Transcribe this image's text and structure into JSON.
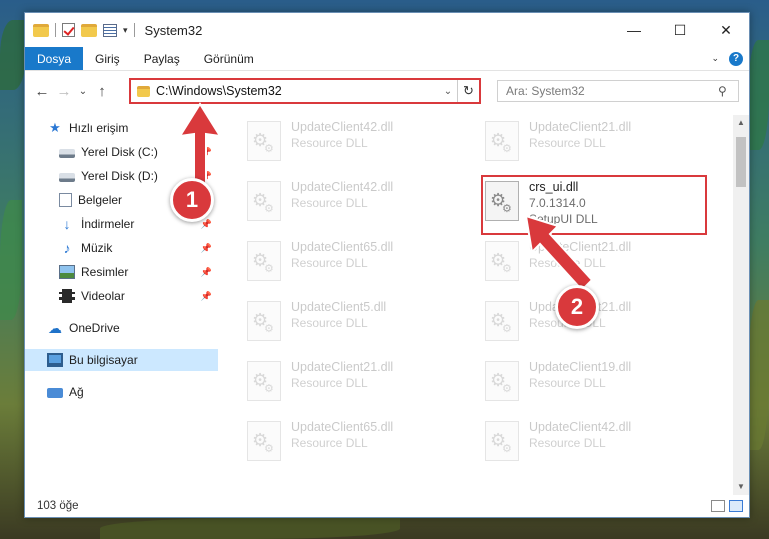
{
  "window": {
    "title": "System32",
    "controls": {
      "minimize": "—",
      "maximize": "☐",
      "close": "✕"
    }
  },
  "quick_access_toolbar": {
    "dropdown_glyph": "▾"
  },
  "ribbon": {
    "tabs": [
      {
        "label": "Dosya"
      },
      {
        "label": "Giriş"
      },
      {
        "label": "Paylaş"
      },
      {
        "label": "Görünüm"
      }
    ],
    "expand_glyph": "⌄",
    "help_glyph": "?"
  },
  "navigation": {
    "back_glyph": "←",
    "forward_glyph": "→",
    "recent_glyph": "⌄",
    "up_glyph": "↑",
    "address": "C:\\Windows\\System32",
    "address_dropdown_glyph": "⌄",
    "refresh_glyph": "↻",
    "search_placeholder": "Ara: System32",
    "search_glyph": "⚲"
  },
  "sidebar": {
    "items": [
      {
        "label": "Hızlı erişim",
        "icon": "star-icon",
        "pinned": false
      },
      {
        "label": "Yerel Disk (C:)",
        "icon": "drive-icon",
        "pinned": true
      },
      {
        "label": "Yerel Disk (D:)",
        "icon": "drive-icon",
        "pinned": true
      },
      {
        "label": "Belgeler",
        "icon": "documents-icon",
        "pinned": true
      },
      {
        "label": "İndirmeler",
        "icon": "downloads-icon",
        "pinned": true
      },
      {
        "label": "Müzik",
        "icon": "music-icon",
        "pinned": true
      },
      {
        "label": "Resimler",
        "icon": "pictures-icon",
        "pinned": true
      },
      {
        "label": "Videolar",
        "icon": "videos-icon",
        "pinned": true
      },
      {
        "label": "OneDrive",
        "icon": "cloud-icon",
        "pinned": false
      },
      {
        "label": "Bu bilgisayar",
        "icon": "computer-icon",
        "pinned": false,
        "selected": true
      },
      {
        "label": "Ağ",
        "icon": "network-icon",
        "pinned": false
      }
    ],
    "pin_glyph": "📌"
  },
  "files": {
    "left_column": [
      {
        "name": "UpdateClient42.dll",
        "type": "Resource DLL"
      },
      {
        "name": "UpdateClient42.dll",
        "type": "Resource DLL"
      },
      {
        "name": "UpdateClient65.dll",
        "type": "Resource DLL"
      },
      {
        "name": "UpdateClient5.dll",
        "type": "Resource DLL"
      },
      {
        "name": "UpdateClient21.dll",
        "type": "Resource DLL"
      },
      {
        "name": "UpdateClient65.dll",
        "type": "Resource DLL"
      }
    ],
    "right_column": [
      {
        "name": "UpdateClient21.dll",
        "type": "Resource DLL"
      },
      {
        "name": "UpdateClient21.dll",
        "type": "Resource DLL"
      },
      {
        "name": "UpdateClient21.dll",
        "type": "Resource DLL"
      },
      {
        "name": "UpdateClient19.dll",
        "type": "Resource DLL"
      },
      {
        "name": "UpdateClient42.dll",
        "type": "Resource DLL"
      }
    ],
    "highlighted": {
      "name": "crs_ui.dll",
      "version": "7.0.1314.0",
      "description": "SetupUI DLL"
    }
  },
  "status": {
    "item_count": "103 öğe"
  },
  "scrollbar": {
    "up_glyph": "▲",
    "down_glyph": "▼"
  },
  "annotations": [
    {
      "label": "1"
    },
    {
      "label": "2"
    }
  ],
  "colors": {
    "accent": "#1979ca",
    "highlight": "#d9393c",
    "selected": "#cce8ff"
  }
}
